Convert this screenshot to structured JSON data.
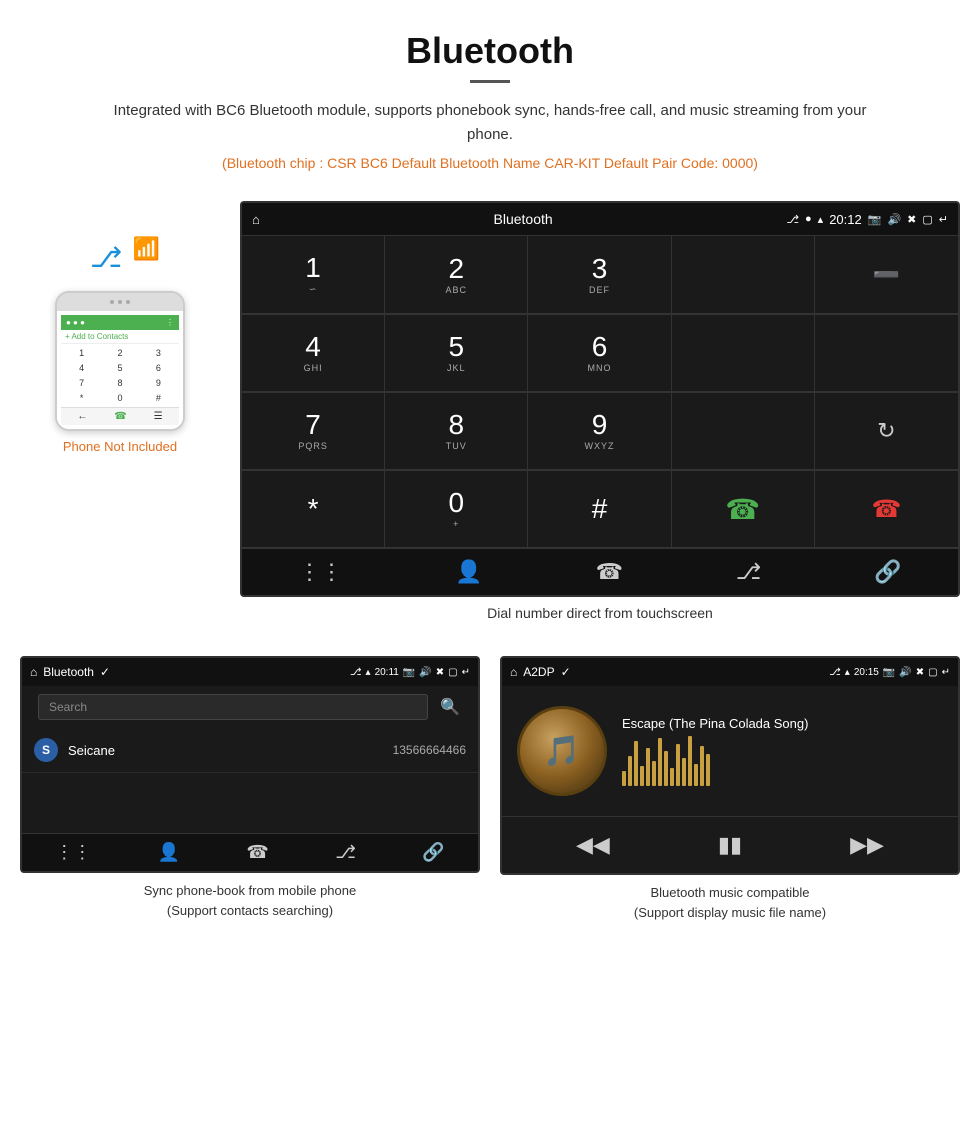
{
  "header": {
    "title": "Bluetooth",
    "description": "Integrated with BC6 Bluetooth module, supports phonebook sync, hands-free call, and music streaming from your phone.",
    "specs": "(Bluetooth chip : CSR BC6    Default Bluetooth Name CAR-KIT    Default Pair Code: 0000)"
  },
  "phone_panel": {
    "not_included_label": "Phone Not Included"
  },
  "main_screen": {
    "status_bar": {
      "title": "Bluetooth",
      "time": "20:12"
    },
    "caption": "Dial number direct from touchscreen",
    "dialpad": {
      "keys": [
        {
          "num": "1",
          "sub": "∽"
        },
        {
          "num": "2",
          "sub": "ABC"
        },
        {
          "num": "3",
          "sub": "DEF"
        },
        {
          "num": "",
          "sub": ""
        },
        {
          "num": "⌫",
          "sub": ""
        },
        {
          "num": "4",
          "sub": "GHI"
        },
        {
          "num": "5",
          "sub": "JKL"
        },
        {
          "num": "6",
          "sub": "MNO"
        },
        {
          "num": "",
          "sub": ""
        },
        {
          "num": "",
          "sub": ""
        },
        {
          "num": "7",
          "sub": "PQRS"
        },
        {
          "num": "8",
          "sub": "TUV"
        },
        {
          "num": "9",
          "sub": "WXYZ"
        },
        {
          "num": "",
          "sub": ""
        },
        {
          "num": "↻",
          "sub": ""
        },
        {
          "num": "*",
          "sub": ""
        },
        {
          "num": "0",
          "sub": "+"
        },
        {
          "num": "#",
          "sub": ""
        },
        {
          "num": "📞",
          "sub": ""
        },
        {
          "num": "📞",
          "sub": "end"
        }
      ]
    }
  },
  "phonebook_screen": {
    "status": {
      "title": "Bluetooth",
      "time": "20:11"
    },
    "search_placeholder": "Search",
    "contacts": [
      {
        "initial": "S",
        "name": "Seicane",
        "number": "13566664466"
      }
    ],
    "caption_line1": "Sync phone-book from mobile phone",
    "caption_line2": "(Support contacts searching)"
  },
  "music_screen": {
    "status": {
      "title": "A2DP",
      "time": "20:15"
    },
    "song_title": "Escape (The Pina Colada Song)",
    "caption_line1": "Bluetooth music compatible",
    "caption_line2": "(Support display music file name)"
  }
}
